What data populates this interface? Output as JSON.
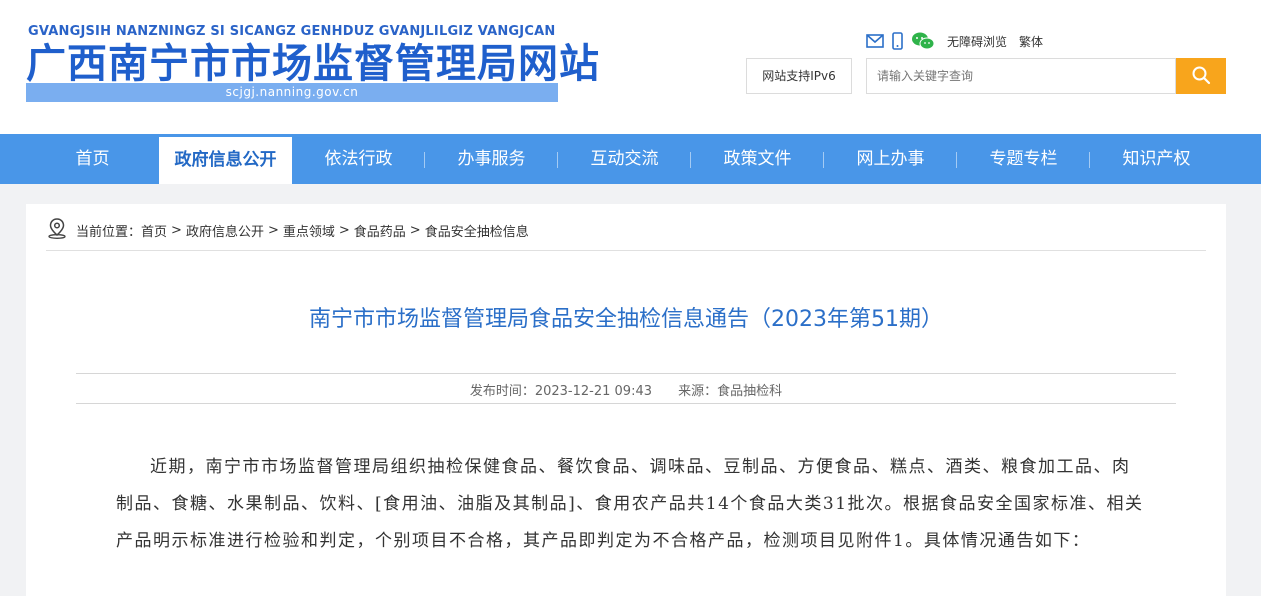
{
  "header": {
    "logo_pinyin": "GVANGJSIH NANZNINGZ SI SICANGZ GENHDUZ GVANJLILGIZ VANGJCAN",
    "logo_title": "广西南宁市市场监督管理局网站",
    "logo_domain": "scjgj.nanning.gov.cn",
    "accessibility_link": "无障碍浏览",
    "traditional_link": "繁体",
    "ipv6_badge": "网站支持IPv6",
    "search_placeholder": "请输入关键字查询"
  },
  "nav": {
    "items": [
      {
        "label": "首页"
      },
      {
        "label": "政府信息公开",
        "active": true
      },
      {
        "label": "依法行政"
      },
      {
        "label": "办事服务"
      },
      {
        "label": "互动交流"
      },
      {
        "label": "政策文件"
      },
      {
        "label": "网上办事"
      },
      {
        "label": "专题专栏"
      },
      {
        "label": "知识产权"
      }
    ]
  },
  "breadcrumb": {
    "prefix": "当前位置：",
    "items": [
      "首页",
      "政府信息公开",
      "重点领域",
      "食品药品",
      "食品安全抽检信息"
    ],
    "separator": ">"
  },
  "article": {
    "title": "南宁市市场监督管理局食品安全抽检信息通告（2023年第51期）",
    "publish_time": "发布时间：2023-12-21 09:43",
    "source": "来源：食品抽检科",
    "body": "近期，南宁市市场监督管理局组织抽检保健食品、餐饮食品、调味品、豆制品、方便食品、糕点、酒类、粮食加工品、肉制品、食糖、水果制品、饮料、[食用油、油脂及其制品]、食用农产品共14个食品大类31批次。根据食品安全国家标准、相关产品明示标准进行检验和判定，个别项目不合格，其产品即判定为不合格产品，检测项目见附件1。具体情况通告如下："
  },
  "colors": {
    "nav_bg": "#4996e8",
    "title_blue": "#2b6fc8",
    "search_button": "#f8a51c",
    "logo_blue": "#1f5fcc"
  }
}
